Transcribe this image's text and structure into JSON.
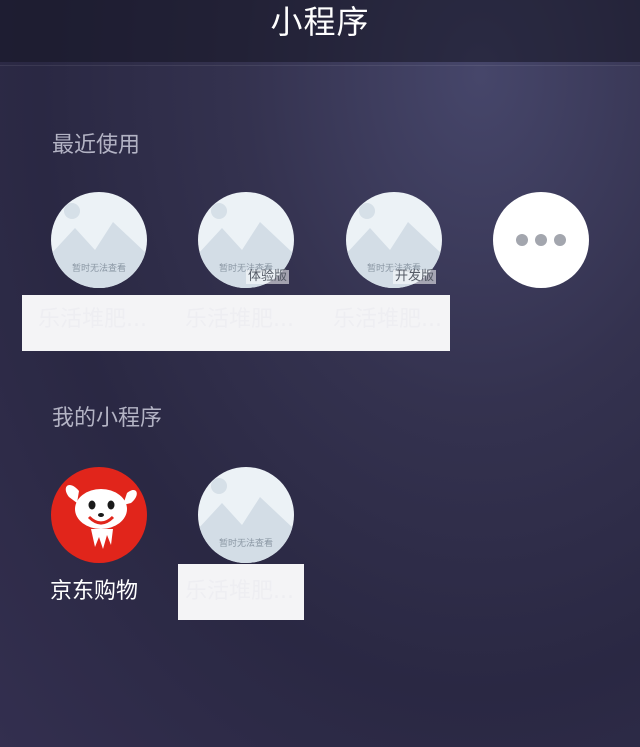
{
  "header": {
    "title": "小程序"
  },
  "recent": {
    "title": "最近使用",
    "items": [
      {
        "label": "乐活堆肥...",
        "placeholder": "暂时无法查看",
        "badge": ""
      },
      {
        "label": "乐活堆肥...",
        "placeholder": "暂时无法查看",
        "badge": "体验版"
      },
      {
        "label": "乐活堆肥...",
        "placeholder": "暂时无法查看",
        "badge": "开发版"
      }
    ]
  },
  "mine": {
    "title": "我的小程序",
    "items": [
      {
        "label": "京东购物"
      },
      {
        "label": "乐活堆肥...",
        "placeholder": "暂时无法查看"
      }
    ]
  },
  "icons": {
    "placeholder": "mountain-image-icon",
    "more": "more-dots-icon",
    "jd": "jd-dog-logo-icon"
  },
  "colors": {
    "jd_red": "#e1251b",
    "placeholder_bg": "#ecf2f6",
    "label_strip": "#f4f4f6"
  }
}
